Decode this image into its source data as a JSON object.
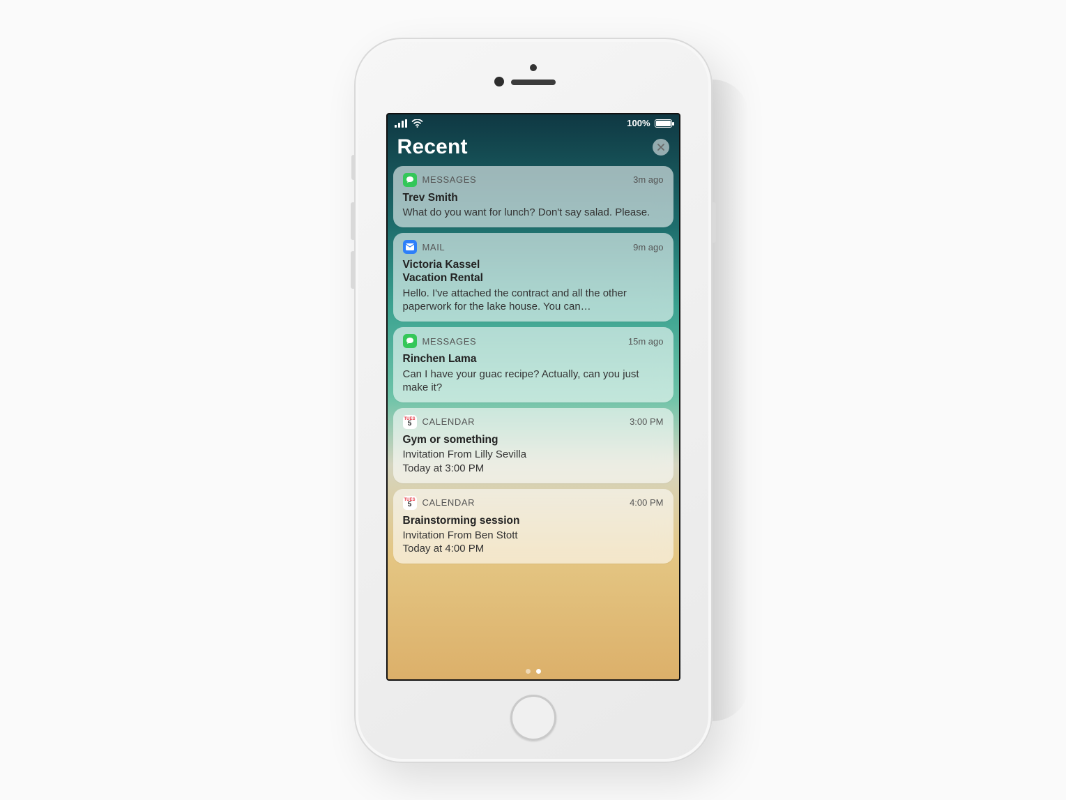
{
  "statusbar": {
    "battery_text": "100%"
  },
  "header": {
    "title": "Recent"
  },
  "icons": {
    "messages": "messages",
    "mail": "mail",
    "calendar_top": "TUES",
    "calendar_day": "5"
  },
  "notifications": [
    {
      "app": "MESSAGES",
      "icon": "messages",
      "time": "3m ago",
      "title": "Trev Smith",
      "subtitle": "",
      "body": "What do you want for lunch? Don't say salad. Please."
    },
    {
      "app": "MAIL",
      "icon": "mail",
      "time": "9m ago",
      "title": "Victoria Kassel",
      "subtitle": "Vacation Rental",
      "body": "Hello. I've attached the contract and all the other paperwork for the lake house. You can…"
    },
    {
      "app": "MESSAGES",
      "icon": "messages",
      "time": "15m ago",
      "title": "Rinchen Lama",
      "subtitle": "",
      "body": "Can I have your guac recipe? Actually, can you just make it?"
    },
    {
      "app": "CALENDAR",
      "icon": "calendar",
      "time": "3:00 PM",
      "title": "Gym or something",
      "subtitle": "",
      "body": "Invitation From Lilly Sevilla\nToday at 3:00 PM"
    },
    {
      "app": "CALENDAR",
      "icon": "calendar",
      "time": "4:00 PM",
      "title": "Brainstorming session",
      "subtitle": "",
      "body": "Invitation From Ben Stott\nToday at 4:00 PM"
    }
  ]
}
